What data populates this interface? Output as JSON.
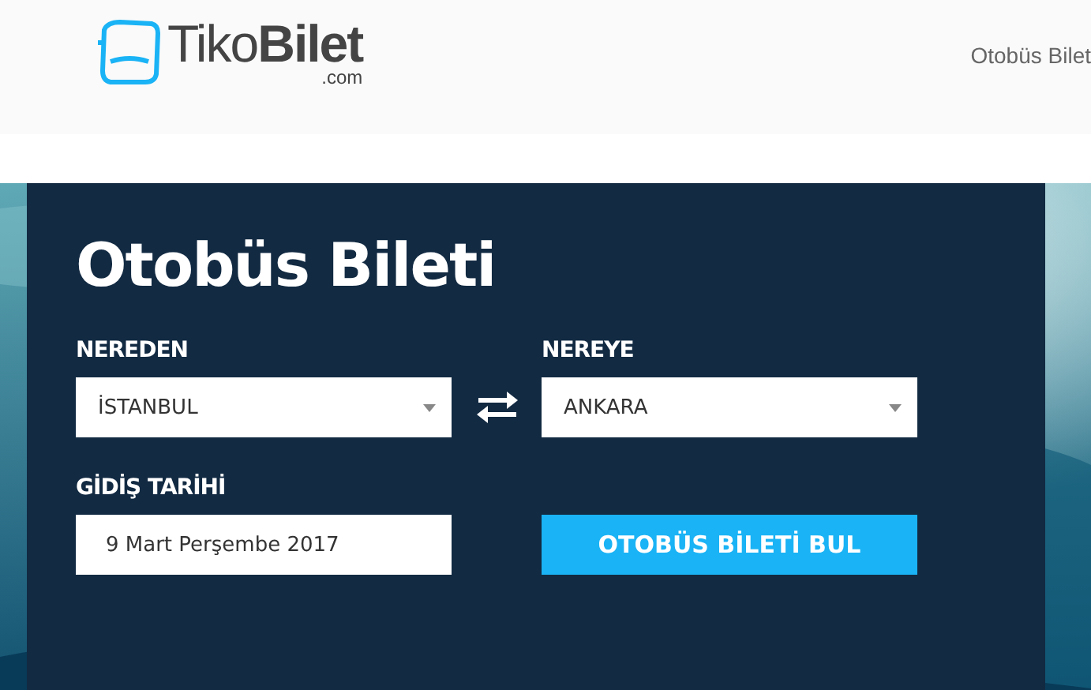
{
  "header": {
    "logo": {
      "light": "Tiko",
      "bold": "Bilet",
      "suffix": ".com"
    },
    "nav": [
      "Otobüs Bilet"
    ]
  },
  "search": {
    "title": "Otobüs Bileti",
    "from": {
      "label": "NEREDEN",
      "value": "İSTANBUL"
    },
    "to": {
      "label": "NEREYE",
      "value": "ANKARA"
    },
    "date": {
      "label": "GİDİŞ TARİHİ",
      "value": "9 Mart Perşembe 2017"
    },
    "button": "OTOBÜS BİLETİ BUL"
  }
}
